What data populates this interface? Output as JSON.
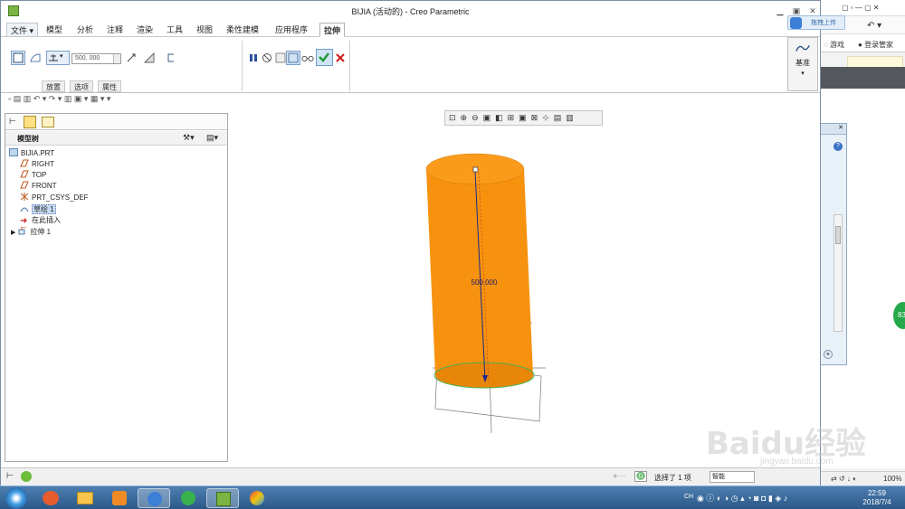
{
  "window": {
    "title": "BIJIA (活动的) - Creo Parametric"
  },
  "menu_tabs": [
    "文件",
    "模型",
    "分析",
    "注释",
    "渲染",
    "工具",
    "视图",
    "柔性建模",
    "应用程序",
    "拉伸"
  ],
  "ribbon": {
    "depth_value": "500. 000",
    "sub_tabs": [
      "放置",
      "选项",
      "属性"
    ],
    "datum_label": "基准"
  },
  "model_tree": {
    "header": "模型树",
    "items": [
      "BIJIA.PRT",
      "RIGHT",
      "TOP",
      "FRONT",
      "PRT_CSYS_DEF",
      "草绘 1",
      "在此插入",
      "拉伸 1"
    ]
  },
  "graphics": {
    "dimension_label": "500.000",
    "model_color": "#f7920f"
  },
  "status_bar": {
    "selection_text": "选择了 1 项",
    "filter_value": "智能"
  },
  "upload_toast": "拖拽上传",
  "browser": {
    "game_label": "游戏",
    "login_label": "登录管家",
    "zoom": "100%"
  },
  "taskbar": {
    "clock_time": "22:59",
    "clock_date": "2018/7/4",
    "ime_label": "CH"
  },
  "watermark": {
    "line1": "Baidu经验",
    "line2": "jingyan.baidu.com"
  }
}
